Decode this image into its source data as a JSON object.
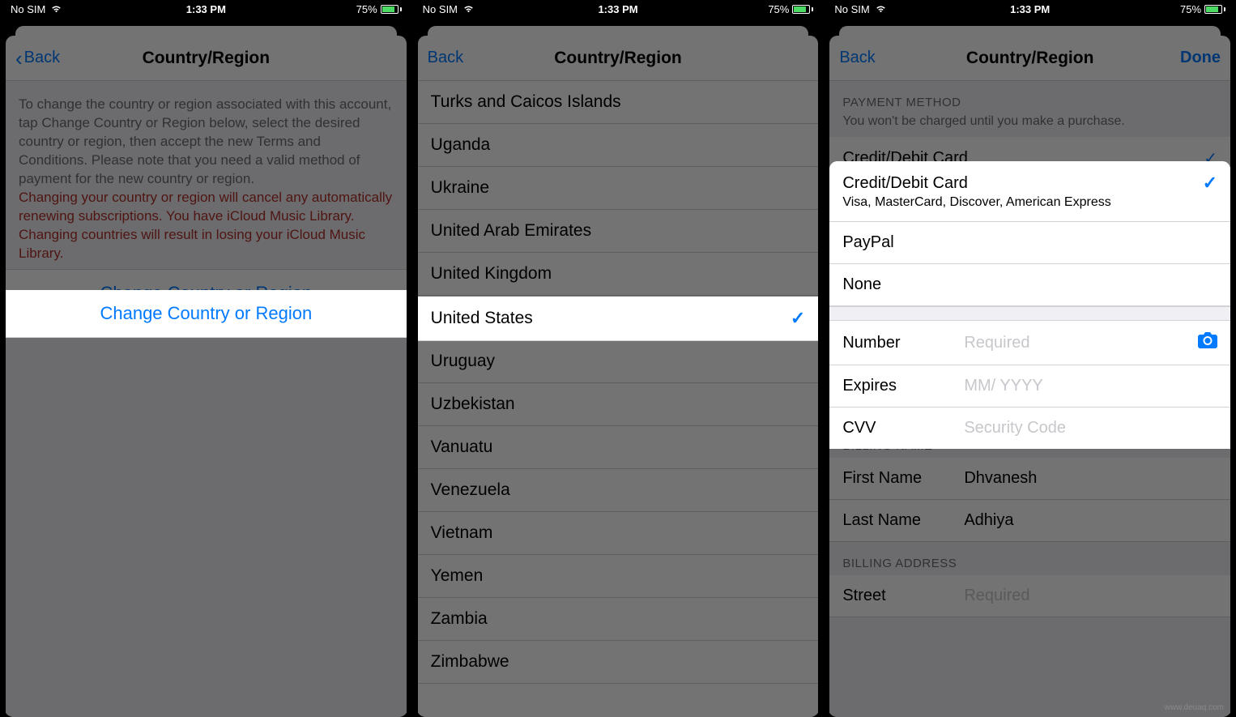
{
  "status": {
    "carrier": "No SIM",
    "time": "1:33 PM",
    "battery_pct": "75%"
  },
  "screen1": {
    "back": "Back",
    "title": "Country/Region",
    "explain": "To change the country or region associated with this account, tap Change Country or Region below, select the desired country or region, then accept the new Terms and Conditions. Please note that you need a valid method of payment for the new country or region.",
    "warning": "Changing your country or region will cancel any automatically renewing subscriptions. You have iCloud Music Library. Changing countries will result in losing your iCloud Music Library.",
    "button": "Change Country or Region"
  },
  "screen2": {
    "back": "Back",
    "title": "Country/Region",
    "countries": [
      "Turks and Caicos Islands",
      "Uganda",
      "Ukraine",
      "United Arab Emirates",
      "United Kingdom",
      "United States",
      "Uruguay",
      "Uzbekistan",
      "Vanuatu",
      "Venezuela",
      "Vietnam",
      "Yemen",
      "Zambia",
      "Zimbabwe"
    ],
    "selected": "United States"
  },
  "screen3": {
    "back": "Back",
    "title": "Country/Region",
    "done": "Done",
    "payment_method_header": "PAYMENT METHOD",
    "payment_note": "You won't be charged until you make a purchase.",
    "options": {
      "credit": {
        "title": "Credit/Debit Card",
        "subtitle": "Visa, MasterCard, Discover, American Express",
        "selected": true
      },
      "paypal": {
        "title": "PayPal",
        "selected": false
      },
      "none": {
        "title": "None",
        "selected": false
      }
    },
    "card_fields": {
      "number": {
        "label": "Number",
        "placeholder": "Required"
      },
      "expires": {
        "label": "Expires",
        "placeholder": "MM/ YYYY"
      },
      "cvv": {
        "label": "CVV",
        "placeholder": "Security Code"
      }
    },
    "billing_name_header": "BILLING NAME",
    "billing_name": {
      "first": {
        "label": "First Name",
        "value": "Dhvanesh"
      },
      "last": {
        "label": "Last Name",
        "value": "Adhiya"
      }
    },
    "billing_address_header": "BILLING ADDRESS",
    "billing_address": {
      "street": {
        "label": "Street",
        "placeholder": "Required"
      }
    }
  },
  "watermark": "www.deuaq.com"
}
